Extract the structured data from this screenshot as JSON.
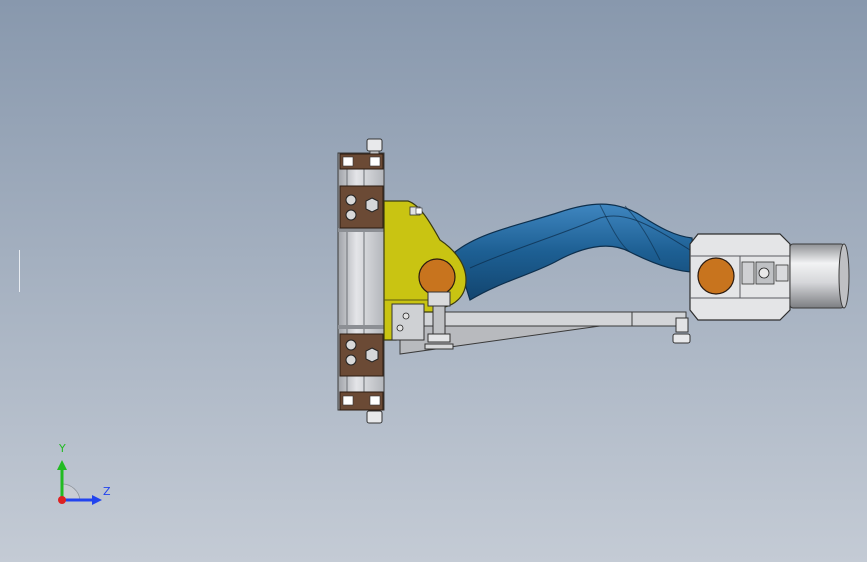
{
  "viewport": {
    "background_top": "#8898ad",
    "background_bottom": "#c4cbd5"
  },
  "model": {
    "parts": [
      {
        "name": "mounting-frame",
        "color": "#c9ccd2"
      },
      {
        "name": "clamp-block",
        "color": "#6b4a35"
      },
      {
        "name": "yellow-bracket",
        "color": "#c9c412"
      },
      {
        "name": "control-arm",
        "color": "#1d5f93"
      },
      {
        "name": "bushing",
        "color": "#c8741e"
      },
      {
        "name": "support-rod",
        "color": "#c7c9cd"
      },
      {
        "name": "end-housing",
        "color": "#dcdde0"
      }
    ]
  },
  "triad": {
    "y_label": "Y",
    "z_label": "Z",
    "y_color": "#22bb22",
    "z_color": "#2244ee",
    "x_color": "#dd2222"
  }
}
